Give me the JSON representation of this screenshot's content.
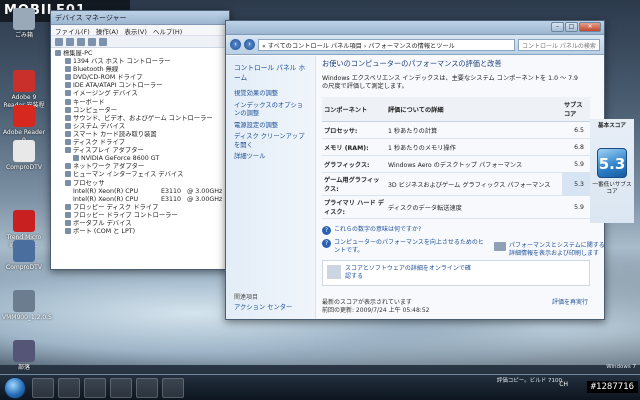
{
  "watermark": {
    "logo": "MOBILE01",
    "photo_id": "#1287716"
  },
  "desktop": {
    "icons": [
      {
        "label": "ごみ箱",
        "color": "#9aa9b8"
      },
      {
        "label": "Adobe 9 Reader 安装程式",
        "color": "#c9302c"
      },
      {
        "label": "Adobe Reader 9",
        "color": "#d6281f"
      },
      {
        "label": "ComproDTV",
        "color": "#e8e8e8"
      },
      {
        "label": "Trend Micro Internet...",
        "color": "#c82020"
      },
      {
        "label": "ComproDTV",
        "color": "#4a6f9e"
      },
      {
        "label": "VMM900_1.2.0.5",
        "color": "#6b7d8f"
      },
      {
        "label": "部落",
        "color": "#557"
      }
    ]
  },
  "devmgr": {
    "title": "デバイス マネージャー",
    "menu": [
      "ファイル(F)",
      "操作(A)",
      "表示(V)",
      "ヘルプ(H)"
    ],
    "tree": [
      {
        "level": 0,
        "label": "標集屋-PC"
      },
      {
        "level": 1,
        "label": "1394 バス ホスト コントローラー"
      },
      {
        "level": 1,
        "label": "Bluetooth 無線"
      },
      {
        "level": 1,
        "label": "DVD/CD-ROM ドライブ"
      },
      {
        "level": 1,
        "label": "IDE ATA/ATAPI コントローラー"
      },
      {
        "level": 1,
        "label": "イメージング デバイス"
      },
      {
        "level": 1,
        "label": "キーボード"
      },
      {
        "level": 1,
        "label": "コンピューター"
      },
      {
        "level": 1,
        "label": "サウンド、ビデオ、およびゲーム コントローラー"
      },
      {
        "level": 1,
        "label": "システム デバイス"
      },
      {
        "level": 1,
        "label": "スマート カード読み取り装置"
      },
      {
        "level": 1,
        "label": "ディスク ドライブ"
      },
      {
        "level": 1,
        "label": "ディスプレイ アダプター"
      },
      {
        "level": 2,
        "label": "NVIDIA GeForce 8600 GT"
      },
      {
        "level": 1,
        "label": "ネットワーク アダプター"
      },
      {
        "level": 1,
        "label": "ヒューマン インターフェイス デバイス"
      },
      {
        "level": 1,
        "label": "プロセッサ"
      }
    ],
    "cpus": [
      {
        "name": "Intel(R) Xeon(R) CPU",
        "model": "E3110",
        "freq": "@ 3.00GHz"
      },
      {
        "name": "Intel(R) Xeon(R) CPU",
        "model": "E3110",
        "freq": "@ 3.00GHz"
      }
    ],
    "tree_tail": [
      {
        "level": 1,
        "label": "フロッピー ディスク ドライブ"
      },
      {
        "level": 1,
        "label": "フロッピー ドライブ コントローラー"
      },
      {
        "level": 1,
        "label": "ポータブル デバイス"
      },
      {
        "level": 1,
        "label": "ポート (COM と LPT)"
      }
    ]
  },
  "perf": {
    "breadcrumb": "« すべてのコントロール パネル項目 › パフォーマンスの情報とツール",
    "search_placeholder": "コントロール パネルの検索",
    "side": {
      "home": "コントロール パネル ホーム",
      "links": [
        "視覚効果の調整",
        "インデックスのオプションの調整",
        "電源設定の調整",
        "ディスク クリーンアップを開く",
        "詳細ツール"
      ],
      "see_also": "関連項目",
      "action_center": "アクション センター"
    },
    "heading": "お使いのコンピューターのパフォーマンスの評価と改善",
    "description": "Windows エクスペリエンス インデックスは、主要なシステム コンポーネントを 1.0 ～ 7.9 の尺度で評価して測定します。",
    "table": {
      "headers": [
        "コンポーネント",
        "評価についての詳細",
        "サブスコア",
        "基本スコア"
      ],
      "rows": [
        {
          "component": "プロセッサ:",
          "detail": "1 秒あたりの計算",
          "score": "6.5"
        },
        {
          "component": "メモリ (RAM):",
          "detail": "1 秒あたりのメモリ操作",
          "score": "6.8"
        },
        {
          "component": "グラフィックス:",
          "detail": "Windows Aero のデスクトップ パフォーマンス",
          "score": "5.9"
        },
        {
          "component": "ゲーム用グラフィックス:",
          "detail": "3D ビジネスおよびゲーム グラフィックス パフォーマンス",
          "score": "5.3"
        },
        {
          "component": "プライマリ ハード ディスク:",
          "detail": "ディスクのデータ転送速度",
          "score": "5.9"
        }
      ]
    },
    "base_score": "5.3",
    "base_caption": "一番低いサブスコア",
    "help_links": [
      "これらの数字の意味は何ですか?",
      "コンピューターのパフォーマンスを向上させるためのヒントです。"
    ],
    "print_link": "パフォーマンスとシステムに関する詳細情報を表示および印刷します",
    "online_link": "スコアとソフトウェアの詳細をオンラインで確認する",
    "footer": {
      "current": "最新のスコアが表示されています",
      "last_update": "前回の更新: 2009/7/24 上午 05:48:52",
      "rerun": "評価を再実行"
    }
  },
  "taskbar": {
    "tray": "CH",
    "wm1": "Windows 7",
    "wm2": "評価コピー。ビルド 7100"
  }
}
